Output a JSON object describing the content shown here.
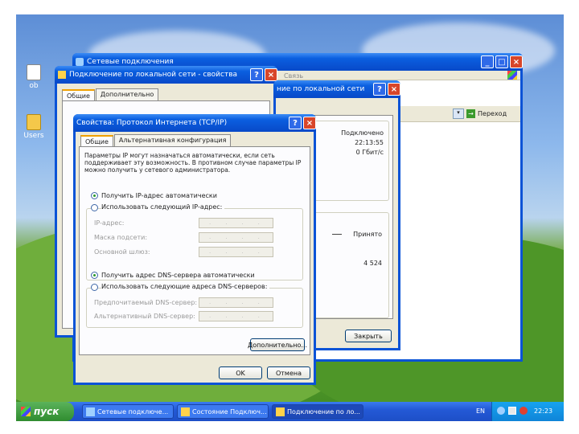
{
  "desktop": {
    "icons": [
      {
        "label": "ob",
        "icon": "document-icon"
      },
      {
        "label": "Users",
        "icon": "folder-icon"
      }
    ]
  },
  "network_connections": {
    "title": "Сетевые подключения",
    "address_right_label": "Переход",
    "line_fragment": "Связь"
  },
  "lan_properties": {
    "title": "Подключение по локальной сети - свойства",
    "tabs": [
      "Общие",
      "Дополнительно"
    ]
  },
  "lan_status": {
    "title": "ние по локальной сети",
    "status_value": "Подключено",
    "duration_value": "22:13:55",
    "speed_value": "0 Гбит/с",
    "received_label": "Принято",
    "received_value": "4 524",
    "close_button": "Закрыть"
  },
  "tcpip": {
    "title": "Свойства: Протокол Интернета (TCP/IP)",
    "tabs": [
      "Общие",
      "Альтернативная конфигурация"
    ],
    "description": "Параметры IP могут назначаться автоматически, если сеть поддерживает эту возможность. В противном случае параметры IP можно получить у сетевого администратора.",
    "ip_auto": "Получить IP-адрес автоматически",
    "ip_manual": "Использовать следующий IP-адрес:",
    "ip_address_label": "IP-адрес:",
    "subnet_label": "Маска подсети:",
    "gateway_label": "Основной шлюз:",
    "dns_auto": "Получить адрес DNS-сервера автоматически",
    "dns_manual": "Использовать следующие адреса DNS-серверов:",
    "dns_pref_label": "Предпочитаемый DNS-сервер:",
    "dns_alt_label": "Альтернативный DNS-сервер:",
    "advanced_button": "Дополнительно...",
    "ok_button": "OK",
    "cancel_button": "Отмена"
  },
  "taskbar": {
    "start_label": "пуск",
    "tasks": [
      "Сетевые подключе...",
      "Состояние Подключ...",
      "Подключение по ло..."
    ],
    "tray_lang": "EN",
    "clock": "22:23"
  },
  "colors": {
    "title_bar": "#0a53d6",
    "close_button": "#d8462a",
    "dialog_face": "#ece9d8",
    "taskbar": "#2459d6",
    "start_button": "#2f8c2f"
  }
}
